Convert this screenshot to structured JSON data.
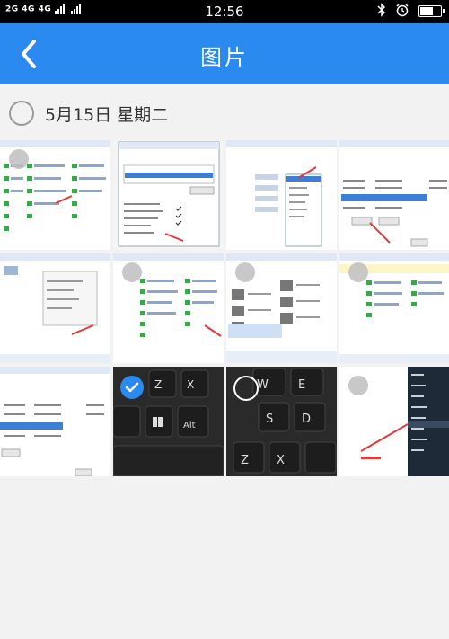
{
  "status_bar": {
    "network": "2G 4G 4G",
    "time": "12:56",
    "icons": [
      "bluetooth-icon",
      "alarm-icon",
      "battery-icon"
    ]
  },
  "header": {
    "title": "图片",
    "back_icon": "chevron-left-icon",
    "color": "#2b8af0"
  },
  "section": {
    "date_label": "5月15日 星期二"
  },
  "photos": [
    {
      "kind": "screenshot-control-panel",
      "selected": false
    },
    {
      "kind": "screenshot-properties-dialog",
      "selected": false
    },
    {
      "kind": "screenshot-settings-dropdown",
      "selected": false
    },
    {
      "kind": "screenshot-permissions-list",
      "selected": false
    },
    {
      "kind": "screenshot-explorer-window",
      "selected": false
    },
    {
      "kind": "screenshot-control-panel-2",
      "selected": false
    },
    {
      "kind": "screenshot-devices-printers",
      "selected": false
    },
    {
      "kind": "screenshot-permissions-list-2",
      "selected": false
    },
    {
      "kind": "screenshot-permissions-list-3",
      "selected": false
    },
    {
      "kind": "photo-keyboard-windows-key",
      "selected": true
    },
    {
      "kind": "photo-keyboard-wse",
      "selected": false
    },
    {
      "kind": "screenshot-context-menu",
      "selected": false
    }
  ]
}
